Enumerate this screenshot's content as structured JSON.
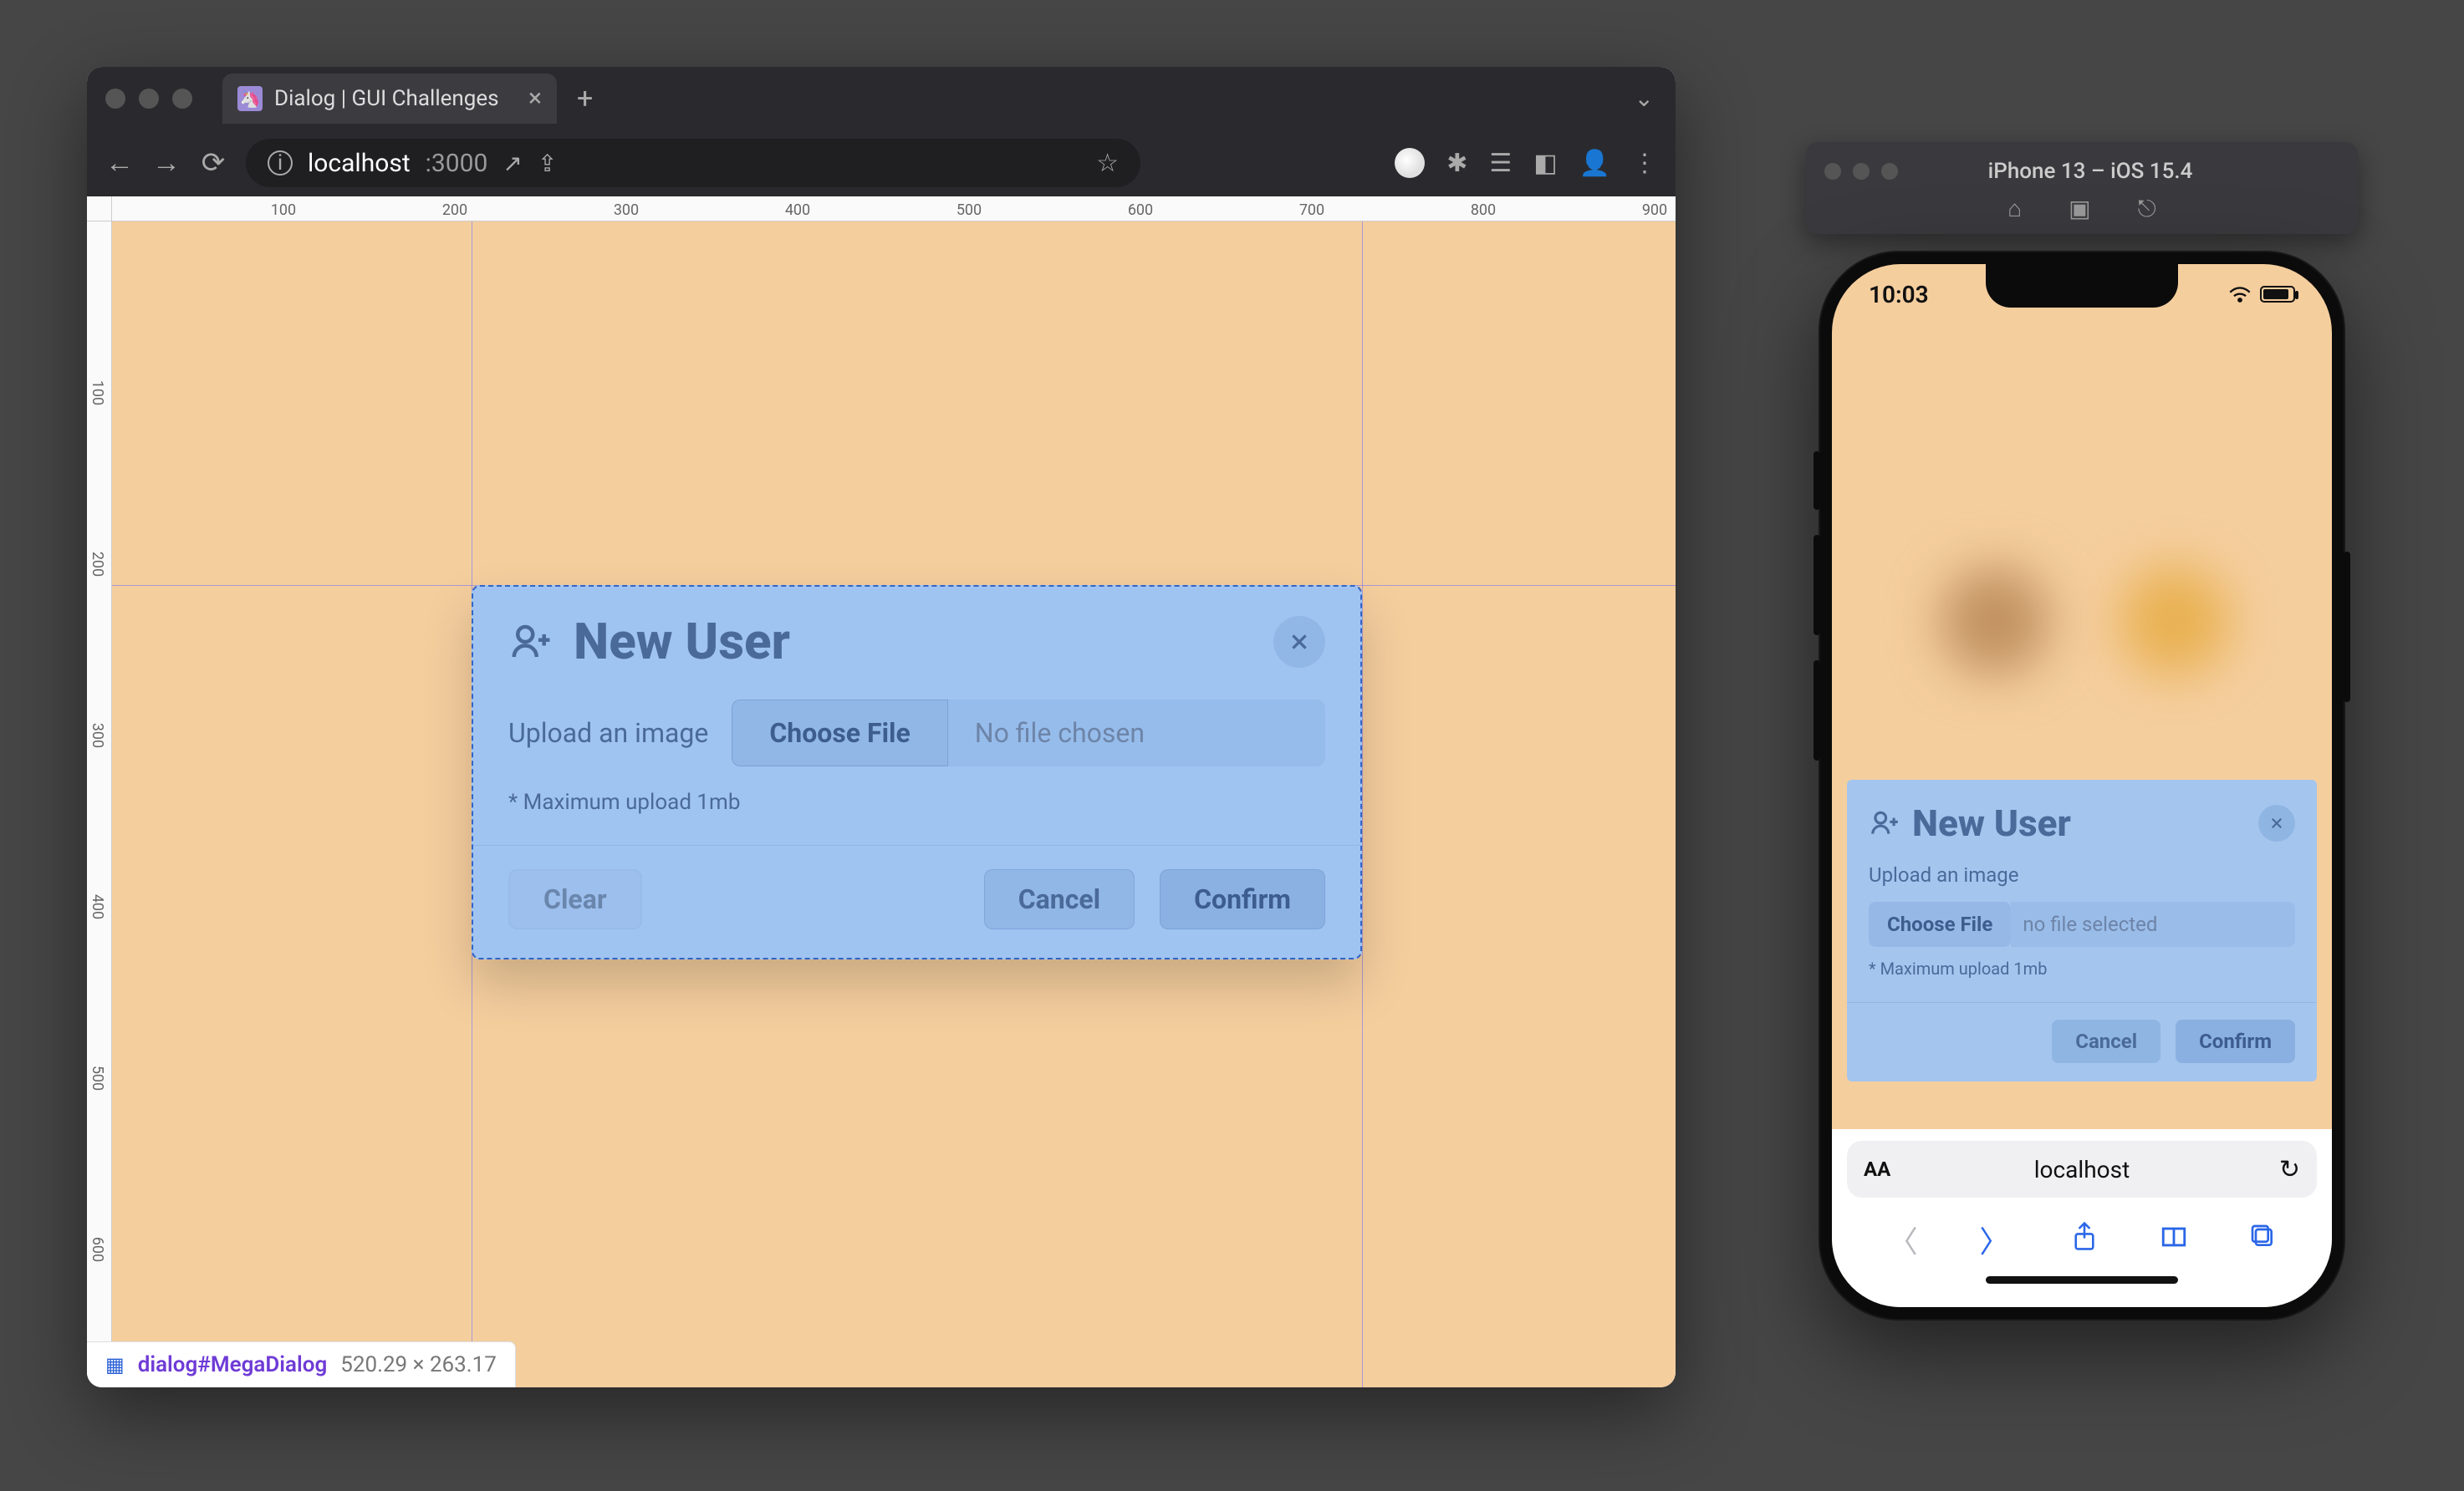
{
  "browser": {
    "tab_title": "Dialog | GUI Challenges",
    "url_host": "localhost",
    "url_port": ":3000",
    "ruler_h": [
      "100",
      "200",
      "300",
      "400",
      "500",
      "600",
      "700",
      "800",
      "900"
    ],
    "ruler_v": [
      "100",
      "200",
      "300",
      "400",
      "500",
      "600"
    ]
  },
  "dialog": {
    "title": "New User",
    "upload_label": "Upload an image",
    "choose_label": "Choose File",
    "file_status": "No file chosen",
    "hint": "* Maximum upload 1mb",
    "clear": "Clear",
    "cancel": "Cancel",
    "confirm": "Confirm"
  },
  "devtools": {
    "selector": "dialog#MegaDialog",
    "dims": "520.29 × 263.17"
  },
  "simulator": {
    "title": "iPhone 13 – iOS 15.4"
  },
  "phone": {
    "time": "10:03",
    "dialog": {
      "title": "New User",
      "upload_label": "Upload an image",
      "choose_label": "Choose File",
      "file_status": "no file selected",
      "hint": "* Maximum upload 1mb",
      "cancel": "Cancel",
      "confirm": "Confirm"
    },
    "safari_url": "localhost"
  }
}
